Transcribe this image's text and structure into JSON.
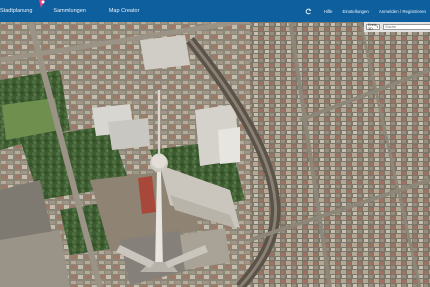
{
  "nav": {
    "items": [
      {
        "label": "Stadtplanung"
      },
      {
        "label": "Sammlungen"
      },
      {
        "label": "Map Creator"
      }
    ]
  },
  "tools": {
    "refresh_icon": "refresh-icon",
    "help": "Hilfe",
    "settings": "Einstellungen",
    "login": "Anmelden / Registrieren"
  },
  "subbar": {
    "view_select": "Kreis 3D",
    "search_placeholder": "Suche"
  },
  "colors": {
    "topbar": "#0e5f9e",
    "logo_accent": "#e8418c"
  },
  "map": {
    "description_icon": "aerial-city-map"
  }
}
